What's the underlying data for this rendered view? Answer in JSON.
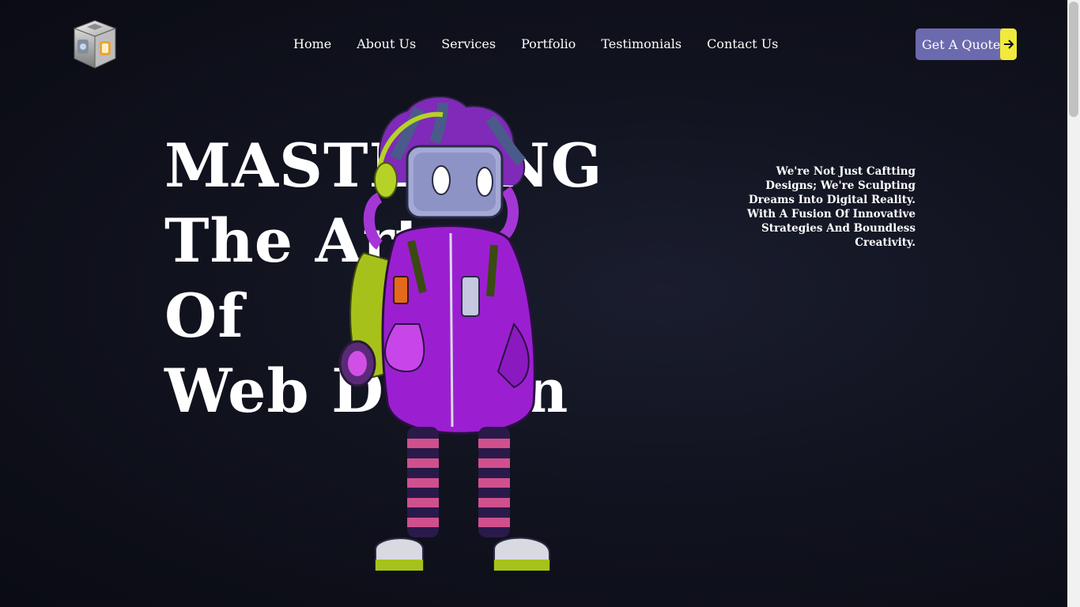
{
  "nav": {
    "items": [
      {
        "label": "Home"
      },
      {
        "label": "About Us"
      },
      {
        "label": "Services"
      },
      {
        "label": "Portfolio"
      },
      {
        "label": "Testimonials"
      },
      {
        "label": "Contact Us"
      }
    ],
    "cta_label": "Get A Quote",
    "cta_icon": "arrow-right-icon"
  },
  "hero": {
    "headline_lines": [
      "MASTERING",
      "The Art",
      "Of",
      "Web Design"
    ],
    "tagline": "We're Not Just Caftting Designs; We're Sculpting Dreams Into Digital Reality. With A Fusion Of Innovative Strategies And Boundless Creativity."
  },
  "colors": {
    "background": "#0b0c15",
    "cta_bg": "#6c6aae",
    "cta_accent": "#f1ea3c",
    "character_purple": "#9b1fd0",
    "character_green": "#a6c21a"
  }
}
